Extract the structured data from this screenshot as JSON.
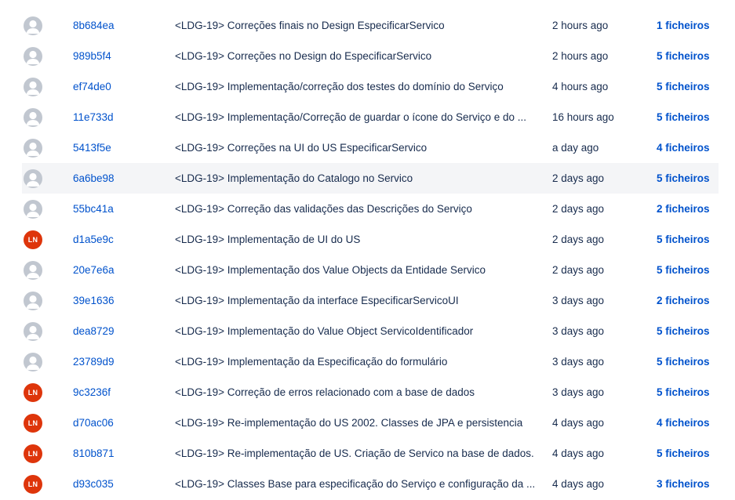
{
  "commits": [
    {
      "avatar": "generic",
      "hash": "8b684ea",
      "message": "<LDG-19> Correções finais no Design EspecificarServico",
      "date": "2 hours ago",
      "files": "1 ficheiros"
    },
    {
      "avatar": "generic",
      "hash": "989b5f4",
      "message": "<LDG-19> Correções no Design do EspecificarServico",
      "date": "2 hours ago",
      "files": "5 ficheiros"
    },
    {
      "avatar": "generic",
      "hash": "ef74de0",
      "message": "<LDG-19> Implementação/correção dos testes do domínio do Serviço",
      "date": "4 hours ago",
      "files": "5 ficheiros"
    },
    {
      "avatar": "generic",
      "hash": "11e733d",
      "message": "<LDG-19> Implementação/Correção de guardar o ícone do Serviço e do ...",
      "date": "16 hours ago",
      "files": "5 ficheiros"
    },
    {
      "avatar": "generic",
      "hash": "5413f5e",
      "message": "<LDG-19> Correções na UI do US EspecificarServico",
      "date": "a day ago",
      "files": "4 ficheiros"
    },
    {
      "avatar": "generic",
      "hash": "6a6be98",
      "message": "<LDG-19> Implementação do Catalogo no Servico",
      "date": "2 days ago",
      "files": "5 ficheiros",
      "hover": true
    },
    {
      "avatar": "generic",
      "hash": "55bc41a",
      "message": "<LDG-19> Correção das validações das Descrições do Serviço",
      "date": "2 days ago",
      "files": "2 ficheiros"
    },
    {
      "avatar": "initials",
      "initials": "LN",
      "hash": "d1a5e9c",
      "message": "<LDG-19> Implementação de UI do US",
      "date": "2 days ago",
      "files": "5 ficheiros"
    },
    {
      "avatar": "generic",
      "hash": "20e7e6a",
      "message": "<LDG-19> Implementação dos Value Objects da Entidade Servico",
      "date": "2 days ago",
      "files": "5 ficheiros"
    },
    {
      "avatar": "generic",
      "hash": "39e1636",
      "message": "<LDG-19> Implementação da interface EspecificarServicoUI",
      "date": "3 days ago",
      "files": "2 ficheiros"
    },
    {
      "avatar": "generic",
      "hash": "dea8729",
      "message": "<LDG-19> Implementação do Value Object ServicoIdentificador",
      "date": "3 days ago",
      "files": "5 ficheiros"
    },
    {
      "avatar": "generic",
      "hash": "23789d9",
      "message": "<LDG-19> Implementação da Especificação do formulário",
      "date": "3 days ago",
      "files": "5 ficheiros"
    },
    {
      "avatar": "initials",
      "initials": "LN",
      "hash": "9c3236f",
      "message": "<LDG-19> Correção de erros relacionado com a base de dados",
      "date": "3 days ago",
      "files": "5 ficheiros"
    },
    {
      "avatar": "initials",
      "initials": "LN",
      "hash": "d70ac06",
      "message": "<LDG-19> Re-implementação do US 2002. Classes de JPA e persistencia",
      "date": "4 days ago",
      "files": "4 ficheiros"
    },
    {
      "avatar": "initials",
      "initials": "LN",
      "hash": "810b871",
      "message": "<LDG-19> Re-implementação de US. Criação de Servico na base de dados.",
      "date": "4 days ago",
      "files": "5 ficheiros"
    },
    {
      "avatar": "initials",
      "initials": "LN",
      "hash": "d93c035",
      "message": "<LDG-19> Classes Base para especificação do Serviço e configuração da ...",
      "date": "4 days ago",
      "files": "3 ficheiros"
    }
  ],
  "colors": {
    "link": "#0052cc",
    "text": "#172b4d",
    "avatar_generic": "#c1c7d0",
    "avatar_initials": "#de350b",
    "row_hover": "#f4f5f7"
  }
}
